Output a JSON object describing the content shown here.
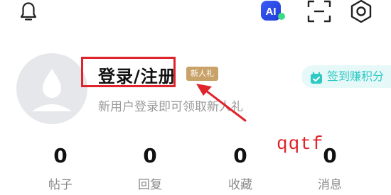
{
  "header": {
    "icons": [
      "bell-icon",
      "ai-icon",
      "scan-icon",
      "gear-icon"
    ],
    "ai_label": "AI"
  },
  "profile": {
    "login_title": "登录/注册",
    "badge": "新人礼",
    "subtitle": "新用户登录即可领取新人礼",
    "checkin_label": "签到赚积分"
  },
  "annotation": {
    "watermark": "qqtf",
    "color": "#e0242b"
  },
  "stats": [
    {
      "value": "0",
      "label": "帖子"
    },
    {
      "value": "0",
      "label": "回复"
    },
    {
      "value": "0",
      "label": "收藏"
    },
    {
      "value": "0",
      "label": "消息"
    }
  ],
  "colors": {
    "accent_teal": "#2fc9c4",
    "badge_gold": "#c9a26a",
    "avatar_bg": "#e5e7ea"
  }
}
